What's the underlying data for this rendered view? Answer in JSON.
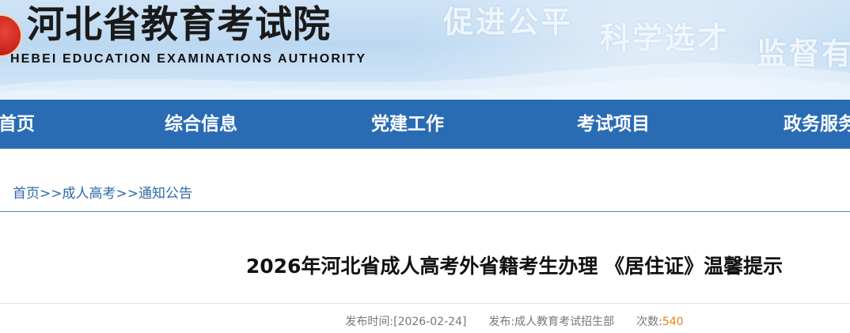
{
  "header": {
    "logo_cn": "河北省教育考试院",
    "logo_en": "HEBEI EDUCATION EXAMINATIONS AUTHORITY",
    "slogans": [
      "促进公平",
      "科学选才",
      "监督有"
    ]
  },
  "nav": {
    "items": [
      "首页",
      "综合信息",
      "党建工作",
      "考试项目",
      "政务服务"
    ]
  },
  "breadcrumb": {
    "items": [
      "首页",
      "成人高考",
      "通知公告"
    ],
    "separator": ">>"
  },
  "article": {
    "title": "2026年河北省成人高考外省籍考生办理 《居住证》温馨提示",
    "meta": {
      "date_label": "发布时间:",
      "date_value": "[2026-02-24]",
      "publisher_label": "发布:",
      "publisher_value": "成人教育考试招生部",
      "views_label": "次数:",
      "views_value": "540"
    }
  },
  "colors": {
    "nav_bg": "#2a6cb4",
    "link": "#2f6aa6",
    "view_count": "#e4830e",
    "emblem": "#c31d18"
  },
  "icons": {
    "logo": "red-emblem-logo"
  }
}
